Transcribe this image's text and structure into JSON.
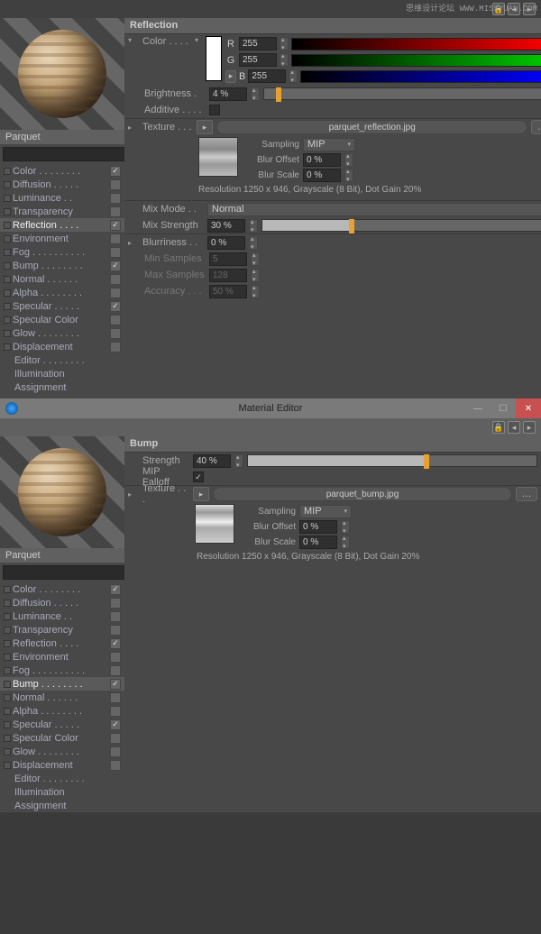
{
  "win1": {
    "watermark": "思维设计论坛 WWW.MISSYUAN.COM",
    "material_name": "Parquet",
    "channels": [
      {
        "label": "Color",
        "on": true,
        "sel": false,
        "dots": ". . . . . . . ."
      },
      {
        "label": "Diffusion",
        "on": false,
        "sel": false,
        "dots": ". . . . ."
      },
      {
        "label": "Luminance",
        "on": false,
        "sel": false,
        "dots": ". ."
      },
      {
        "label": "Transparency",
        "on": false,
        "sel": false,
        "dots": ""
      },
      {
        "label": "Reflection",
        "on": true,
        "sel": true,
        "dots": ". . . ."
      },
      {
        "label": "Environment",
        "on": false,
        "sel": false,
        "dots": ""
      },
      {
        "label": "Fog",
        "on": false,
        "sel": false,
        "dots": ". . . . . . . . . ."
      },
      {
        "label": "Bump",
        "on": true,
        "sel": false,
        "dots": ". . . . . . . ."
      },
      {
        "label": "Normal",
        "on": false,
        "sel": false,
        "dots": ". . . . . ."
      },
      {
        "label": "Alpha",
        "on": false,
        "sel": false,
        "dots": ". . . . . . . ."
      },
      {
        "label": "Specular",
        "on": true,
        "sel": false,
        "dots": ". . . . ."
      },
      {
        "label": "Specular Color",
        "on": false,
        "sel": false,
        "dots": ""
      },
      {
        "label": "Glow",
        "on": false,
        "sel": false,
        "dots": ". . . . . . . ."
      },
      {
        "label": "Displacement",
        "on": false,
        "sel": false,
        "dots": ""
      },
      {
        "label": "Editor",
        "on": null,
        "sel": false,
        "dots": ". . . . . . . ."
      },
      {
        "label": "Illumination",
        "on": null,
        "sel": false,
        "dots": ""
      },
      {
        "label": "Assignment",
        "on": null,
        "sel": false,
        "dots": ""
      }
    ],
    "section": "Reflection",
    "color": {
      "label": "Color . . . .",
      "r_lbl": "R",
      "g_lbl": "G",
      "b_lbl": "B",
      "r": "255",
      "g": "255",
      "b": "255"
    },
    "brightness": {
      "label": "Brightness .",
      "value": "4 %",
      "pct": 4
    },
    "additive": {
      "label": "Additive . . . .",
      "on": false
    },
    "texture": {
      "label": "Texture . . .",
      "file": "parquet_reflection.jpg",
      "sampling_lbl": "Sampling",
      "sampling": "MIP",
      "blur_offset_lbl": "Blur Offset",
      "blur_offset": "0 %",
      "blur_scale_lbl": "Blur Scale",
      "blur_scale": "0 %",
      "resolution": "Resolution 1250 x 946, Grayscale (8 Bit), Dot Gain 20%"
    },
    "mixmode": {
      "label": "Mix Mode . .",
      "value": "Normal"
    },
    "mixstrength": {
      "label": "Mix Strength",
      "value": "30 %",
      "pct": 30
    },
    "blur": {
      "label": "Blurriness . .",
      "value": "0 %",
      "min_lbl": "Min Samples",
      "min": "5",
      "max_lbl": "Max Samples",
      "max": "128",
      "acc_lbl": "Accuracy . . .",
      "acc": "50 %"
    }
  },
  "win2": {
    "title": "Material Editor",
    "material_name": "Parquet",
    "channels": [
      {
        "label": "Color",
        "on": true,
        "sel": false,
        "dots": ". . . . . . . ."
      },
      {
        "label": "Diffusion",
        "on": false,
        "sel": false,
        "dots": ". . . . ."
      },
      {
        "label": "Luminance",
        "on": false,
        "sel": false,
        "dots": ". ."
      },
      {
        "label": "Transparency",
        "on": false,
        "sel": false,
        "dots": ""
      },
      {
        "label": "Reflection",
        "on": true,
        "sel": false,
        "dots": ". . . ."
      },
      {
        "label": "Environment",
        "on": false,
        "sel": false,
        "dots": ""
      },
      {
        "label": "Fog",
        "on": false,
        "sel": false,
        "dots": ". . . . . . . . . ."
      },
      {
        "label": "Bump",
        "on": true,
        "sel": true,
        "dots": ". . . . . . . ."
      },
      {
        "label": "Normal",
        "on": false,
        "sel": false,
        "dots": ". . . . . ."
      },
      {
        "label": "Alpha",
        "on": false,
        "sel": false,
        "dots": ". . . . . . . ."
      },
      {
        "label": "Specular",
        "on": true,
        "sel": false,
        "dots": ". . . . ."
      },
      {
        "label": "Specular Color",
        "on": false,
        "sel": false,
        "dots": ""
      },
      {
        "label": "Glow",
        "on": false,
        "sel": false,
        "dots": ". . . . . . . ."
      },
      {
        "label": "Displacement",
        "on": false,
        "sel": false,
        "dots": ""
      },
      {
        "label": "Editor",
        "on": null,
        "sel": false,
        "dots": ". . . . . . . ."
      },
      {
        "label": "Illumination",
        "on": null,
        "sel": false,
        "dots": ""
      },
      {
        "label": "Assignment",
        "on": null,
        "sel": false,
        "dots": ""
      }
    ],
    "section": "Bump",
    "strength": {
      "label": "Strength",
      "value": "40 %",
      "pct": 61
    },
    "mip": {
      "label": "MIP Falloff",
      "on": true
    },
    "texture": {
      "label": "Texture . . .",
      "file": "parquet_bump.jpg",
      "sampling_lbl": "Sampling",
      "sampling": "MIP",
      "blur_offset_lbl": "Blur Offset",
      "blur_offset": "0 %",
      "blur_scale_lbl": "Blur Scale",
      "blur_scale": "0 %",
      "resolution": "Resolution 1250 x 946, Grayscale (8 Bit), Dot Gain 20%"
    }
  }
}
